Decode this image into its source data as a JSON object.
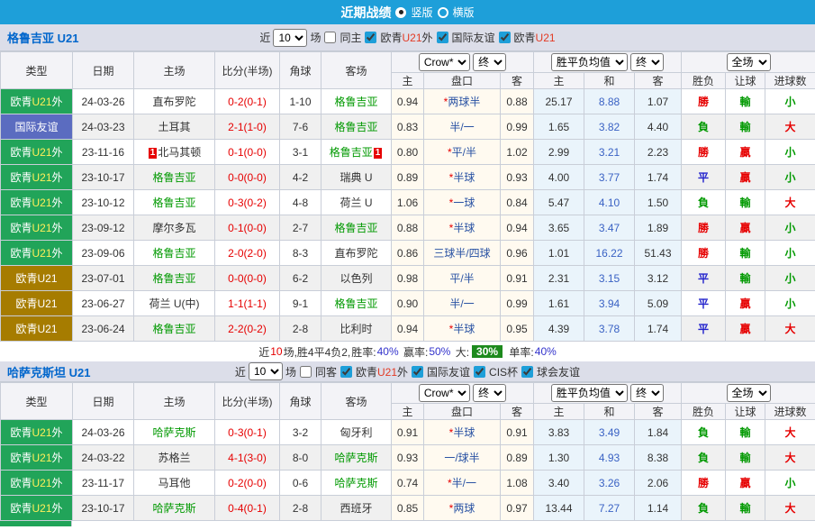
{
  "topbar": {
    "title": "近期战绩",
    "options": [
      {
        "label": "竖版",
        "selected": true
      },
      {
        "label": "横版",
        "selected": false
      }
    ]
  },
  "colors": {
    "topbar": "#1e9fd9",
    "league_out": "#21a459",
    "league_friendly": "#5b6cc0",
    "league_u21": "#a67c00",
    "win": "#e60000",
    "draw": "#2222cc",
    "lose": "#009900",
    "self_team": "#009900",
    "score": "#e60000",
    "rate_badge": "#1d8a1d"
  },
  "leagues": {
    "out": {
      "label": "欧青U21外"
    },
    "friendly": {
      "label": "国际友谊"
    },
    "u21": {
      "label": "欧青U21"
    }
  },
  "table": {
    "columns": {
      "type": "类型",
      "date": "日期",
      "home": "主场",
      "score": "比分(半场)",
      "corner": "角球",
      "away": "客场",
      "odds_home": "主",
      "handicap": "盘口",
      "odds_away": "客",
      "avg_home": "主",
      "avg_draw": "和",
      "avg_away": "客",
      "wdl": "胜负",
      "let_ball": "让球",
      "goals": "进球数"
    },
    "dropdowns": {
      "company": "Crow*",
      "final1": "终",
      "avg": "胜平负均值",
      "final2": "终",
      "scope": "全场"
    }
  },
  "sections": [
    {
      "team": "格鲁吉亚 U21",
      "filter": {
        "near": "近",
        "count": "10",
        "unit": "场",
        "same": {
          "label": "同主",
          "checked": false
        },
        "leagues": [
          {
            "label": "欧青U21外",
            "checked": true
          },
          {
            "label": "国际友谊",
            "checked": true
          },
          {
            "label": "欧青U21",
            "checked": true
          }
        ]
      },
      "rows": [
        {
          "league": "out",
          "date": "24-03-26",
          "home": {
            "name": "直布罗陀"
          },
          "score": "0-2(0-1)",
          "corners": "1-10",
          "away": {
            "name": "格鲁吉亚",
            "self": true
          },
          "o1": "0.94",
          "pan": "*两球半",
          "o2": "0.88",
          "avg": [
            "25.17",
            "8.88",
            "1.07"
          ],
          "res": [
            "勝",
            "輸",
            "小"
          ]
        },
        {
          "league": "friendly",
          "date": "24-03-23",
          "home": {
            "name": "土耳其"
          },
          "score": "2-1(1-0)",
          "corners": "7-6",
          "away": {
            "name": "格鲁吉亚",
            "self": true
          },
          "o1": "0.83",
          "pan": "半/一",
          "o2": "0.99",
          "avg": [
            "1.65",
            "3.82",
            "4.40"
          ],
          "res": [
            "負",
            "輸",
            "大"
          ]
        },
        {
          "league": "out",
          "date": "23-11-16",
          "home": {
            "name": "北马其顿",
            "card": "1"
          },
          "score": "0-1(0-0)",
          "corners": "3-1",
          "away": {
            "name": "格鲁吉亚",
            "self": true,
            "card": "1"
          },
          "o1": "0.80",
          "pan": "*平/半",
          "o2": "1.02",
          "avg": [
            "2.99",
            "3.21",
            "2.23"
          ],
          "res": [
            "勝",
            "贏",
            "小"
          ]
        },
        {
          "league": "out",
          "date": "23-10-17",
          "home": {
            "name": "格鲁吉亚",
            "self": true
          },
          "score": "0-0(0-0)",
          "corners": "4-2",
          "away": {
            "name": "瑞典 U"
          },
          "o1": "0.89",
          "pan": "*半球",
          "o2": "0.93",
          "avg": [
            "4.00",
            "3.77",
            "1.74"
          ],
          "res": [
            "平",
            "贏",
            "小"
          ]
        },
        {
          "league": "out",
          "date": "23-10-12",
          "home": {
            "name": "格鲁吉亚",
            "self": true
          },
          "score": "0-3(0-2)",
          "corners": "4-8",
          "away": {
            "name": "荷兰 U"
          },
          "o1": "1.06",
          "pan": "*一球",
          "o2": "0.84",
          "avg": [
            "5.47",
            "4.10",
            "1.50"
          ],
          "res": [
            "負",
            "輸",
            "大"
          ]
        },
        {
          "league": "out",
          "date": "23-09-12",
          "home": {
            "name": "摩尔多瓦"
          },
          "score": "0-1(0-0)",
          "corners": "2-7",
          "away": {
            "name": "格鲁吉亚",
            "self": true
          },
          "o1": "0.88",
          "pan": "*半球",
          "o2": "0.94",
          "avg": [
            "3.65",
            "3.47",
            "1.89"
          ],
          "res": [
            "勝",
            "贏",
            "小"
          ]
        },
        {
          "league": "out",
          "date": "23-09-06",
          "home": {
            "name": "格鲁吉亚",
            "self": true
          },
          "score": "2-0(2-0)",
          "corners": "8-3",
          "away": {
            "name": "直布罗陀"
          },
          "o1": "0.86",
          "pan": "三球半/四球",
          "o2": "0.96",
          "avg": [
            "1.01",
            "16.22",
            "51.43"
          ],
          "res": [
            "勝",
            "輸",
            "小"
          ]
        },
        {
          "league": "u21",
          "date": "23-07-01",
          "home": {
            "name": "格鲁吉亚",
            "self": true
          },
          "score": "0-0(0-0)",
          "corners": "6-2",
          "away": {
            "name": "以色列"
          },
          "o1": "0.98",
          "pan": "平/半",
          "o2": "0.91",
          "avg": [
            "2.31",
            "3.15",
            "3.12"
          ],
          "res": [
            "平",
            "輸",
            "小"
          ]
        },
        {
          "league": "u21",
          "date": "23-06-27",
          "home": {
            "name": "荷兰 U(中)"
          },
          "score": "1-1(1-1)",
          "corners": "9-1",
          "away": {
            "name": "格鲁吉亚",
            "self": true
          },
          "o1": "0.90",
          "pan": "半/一",
          "o2": "0.99",
          "avg": [
            "1.61",
            "3.94",
            "5.09"
          ],
          "res": [
            "平",
            "贏",
            "小"
          ]
        },
        {
          "league": "u21",
          "date": "23-06-24",
          "home": {
            "name": "格鲁吉亚",
            "self": true
          },
          "score": "2-2(0-2)",
          "corners": "2-8",
          "away": {
            "name": "比利时"
          },
          "o1": "0.94",
          "pan": "*半球",
          "o2": "0.95",
          "avg": [
            "4.39",
            "3.78",
            "1.74"
          ],
          "res": [
            "平",
            "贏",
            "大"
          ]
        }
      ],
      "summary": {
        "prefix": "近",
        "count": "10",
        "mid": "场,胜4平4负2, ",
        "win_rate_label": "胜率:",
        "win_rate": "40%",
        "handicap_rate_label": "赢率:",
        "handicap_rate": "50%",
        "big_label": "大:",
        "big_rate": "30%",
        "odd_rate_label": "单率:",
        "odd_rate": "40%"
      }
    },
    {
      "team": "哈萨克斯坦 U21",
      "filter": {
        "near": "近",
        "count": "10",
        "unit": "场",
        "same": {
          "label": "同客",
          "checked": false
        },
        "leagues": [
          {
            "label": "欧青U21外",
            "checked": true
          },
          {
            "label": "国际友谊",
            "checked": true
          },
          {
            "label": "CIS杯",
            "checked": true
          },
          {
            "label": "球会友谊",
            "checked": true
          }
        ]
      },
      "rows": [
        {
          "league": "out",
          "date": "24-03-26",
          "home": {
            "name": "哈萨克斯",
            "self": true
          },
          "score": "0-3(0-1)",
          "corners": "3-2",
          "away": {
            "name": "匈牙利"
          },
          "o1": "0.91",
          "pan": "*半球",
          "o2": "0.91",
          "avg": [
            "3.83",
            "3.49",
            "1.84"
          ],
          "res": [
            "負",
            "輸",
            "大"
          ]
        },
        {
          "league": "out",
          "date": "24-03-22",
          "home": {
            "name": "苏格兰"
          },
          "score": "4-1(3-0)",
          "corners": "8-0",
          "away": {
            "name": "哈萨克斯",
            "self": true
          },
          "o1": "0.93",
          "pan": "一/球半",
          "o2": "0.89",
          "avg": [
            "1.30",
            "4.93",
            "8.38"
          ],
          "res": [
            "負",
            "輸",
            "大"
          ]
        },
        {
          "league": "out",
          "date": "23-11-17",
          "home": {
            "name": "马耳他"
          },
          "score": "0-2(0-0)",
          "corners": "0-6",
          "away": {
            "name": "哈萨克斯",
            "self": true
          },
          "o1": "0.74",
          "pan": "*半/一",
          "o2": "1.08",
          "avg": [
            "3.40",
            "3.26",
            "2.06"
          ],
          "res": [
            "勝",
            "贏",
            "小"
          ]
        },
        {
          "league": "out",
          "date": "23-10-17",
          "home": {
            "name": "哈萨克斯",
            "self": true
          },
          "score": "0-4(0-1)",
          "corners": "2-8",
          "away": {
            "name": "西班牙"
          },
          "o1": "0.85",
          "pan": "*两球",
          "o2": "0.97",
          "avg": [
            "13.44",
            "7.27",
            "1.14"
          ],
          "res": [
            "負",
            "輸",
            "大"
          ]
        }
      ]
    }
  ]
}
